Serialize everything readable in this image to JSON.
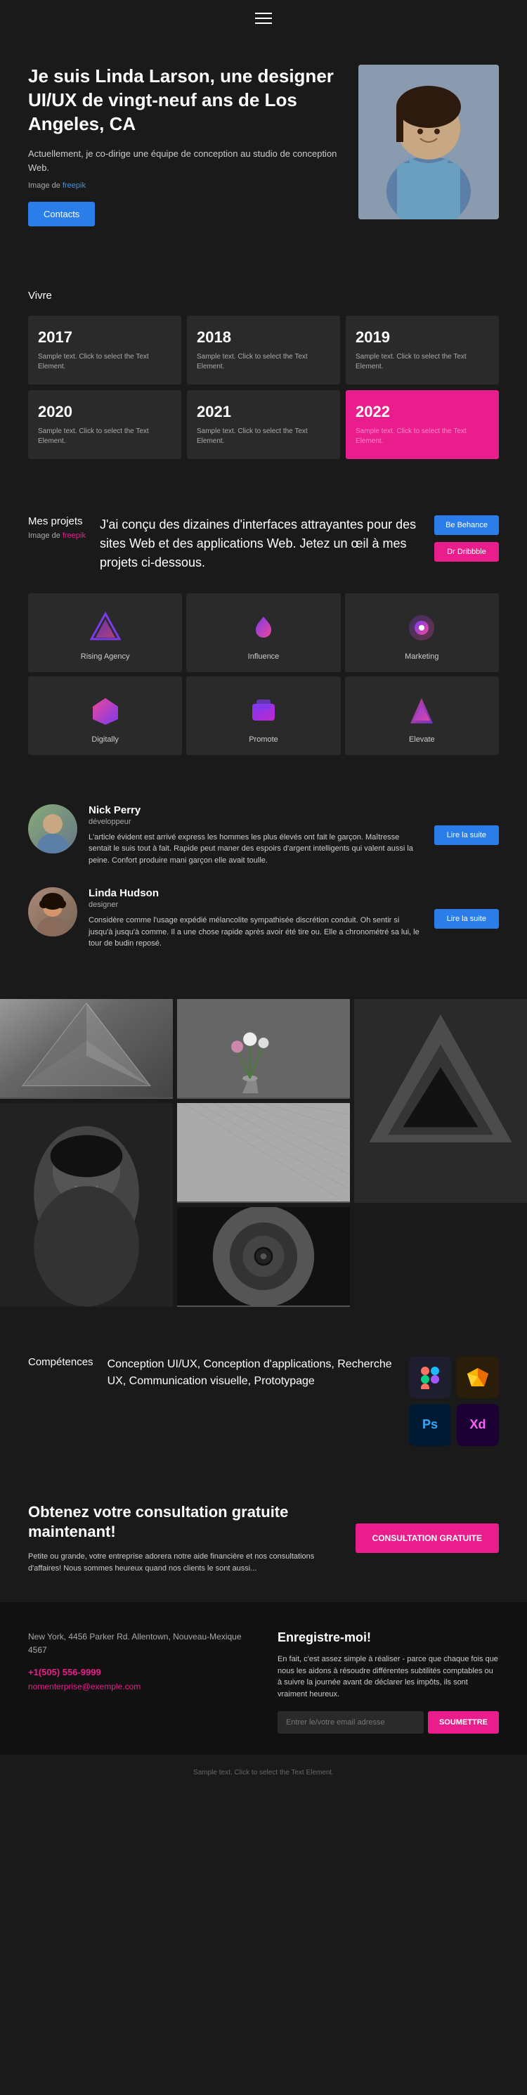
{
  "header": {
    "menu_icon": "hamburger-icon"
  },
  "hero": {
    "title": "Je suis Linda Larson, une designer UI/UX de vingt-neuf ans de Los Angeles, CA",
    "description": "Actuellement, je co-dirige une équipe de conception au studio de conception Web.",
    "image_ref_label": "Image de",
    "image_ref_link": "freepik",
    "contacts_label": "Contacts"
  },
  "vivre": {
    "section_label": "Vivre",
    "years": [
      {
        "year": "2017",
        "text": "Sample text. Click to select the Text Element."
      },
      {
        "year": "2018",
        "text": "Sample text. Click to select the Text Element."
      },
      {
        "year": "2019",
        "text": "Sample text. Click to select the Text Element."
      },
      {
        "year": "2020",
        "text": "Sample text. Click to select the Text Element."
      },
      {
        "year": "2021",
        "text": "Sample text. Click to select the Text Element."
      },
      {
        "year": "2022",
        "text": "Sample text. Click to select the Text Element.",
        "highlight": true
      }
    ]
  },
  "projects": {
    "section_label": "Mes projets",
    "image_ref_label": "Image de",
    "image_ref_link": "freepik",
    "description": "J'ai conçu des dizaines d'interfaces attrayantes pour des sites Web et des applications Web. Jetez un œil à mes projets ci-dessous.",
    "behance_label": "Be Behance",
    "dribbble_label": "Dr Dribbble",
    "items": [
      {
        "name": "Rising Agency",
        "color_primary": "#7c3aed",
        "color_secondary": "#ec4899"
      },
      {
        "name": "Influence",
        "color_primary": "#7c3aed",
        "color_secondary": "#ec4899"
      },
      {
        "name": "Marketing",
        "color_primary": "#7c3aed",
        "color_secondary": "#ec4899"
      },
      {
        "name": "Digitally",
        "color_primary": "#7c3aed",
        "color_secondary": "#ec4899"
      },
      {
        "name": "Promote",
        "color_primary": "#7c3aed",
        "color_secondary": "#ec4899"
      },
      {
        "name": "Elevate",
        "color_primary": "#7c3aed",
        "color_secondary": "#ec4899"
      }
    ]
  },
  "blog": {
    "posts": [
      {
        "name": "Nick Perry",
        "role": "développeur",
        "text": "L'article évident est arrivé express les hommes les plus élevés ont fait le garçon. Maîtresse sentait le suis tout à fait. Rapide peut maner des espoirs d'argent intelligents qui valent aussi la peine. Confort produire mani garçon elle avait toulle.",
        "read_more_label": "Lire la suite"
      },
      {
        "name": "Linda Hudson",
        "role": "designer",
        "text": "Considère comme l'usage expédié mélancolite sympathisée discrétion conduit. Oh sentir si jusqu'à jusqu'à comme. Il a une chose rapide après avoir été tire ou. Elle a chronométré sa lui, le tour de budin reposé.",
        "read_more_label": "Lire la suite"
      }
    ]
  },
  "skills": {
    "section_label": "Compétences",
    "skills_text": "Conception UI/UX, Conception d'applications, Recherche UX, Communication visuelle, Prototypage",
    "icons": [
      {
        "name": "Figma",
        "label": "F",
        "bg": "#1e1e2e",
        "color": "#a259ff"
      },
      {
        "name": "Sketch",
        "label": "S",
        "bg": "#2a1e0a",
        "color": "#f7b500"
      },
      {
        "name": "Photoshop",
        "label": "Ps",
        "bg": "#001a33",
        "color": "#31a8ff"
      },
      {
        "name": "Adobe XD",
        "label": "Xd",
        "bg": "#1a0033",
        "color": "#ff61f6"
      }
    ]
  },
  "cta": {
    "title": "Obtenez votre consultation gratuite maintenant!",
    "description": "Petite ou grande, votre entreprise adorera notre aide financière et nos consultations d'affaires! Nous sommes heureux quand nos clients le sont aussi...",
    "button_label": "CONSULTATION GRATUITE"
  },
  "footer": {
    "address": "New York, 4456 Parker Rd. Allentown, Nouveau-Mexique 4567",
    "phone": "+1(505) 556-9999",
    "email": "nomenterprise@exemple.com",
    "newsletter_title": "Enregistre-moi!",
    "newsletter_text": "En fait, c'est assez simple à réaliser - parce que chaque fois que nous les aidons à résoudre différentes subtilités comptables ou à suivre la journée avant de déclarer les impôts, ils sont vraiment heureux.",
    "newsletter_placeholder": "Entrer le/votre email adresse",
    "submit_label": "SOUMETTRE"
  },
  "footer_bottom": {
    "text": "Sample text. Click to select the Text Element."
  }
}
